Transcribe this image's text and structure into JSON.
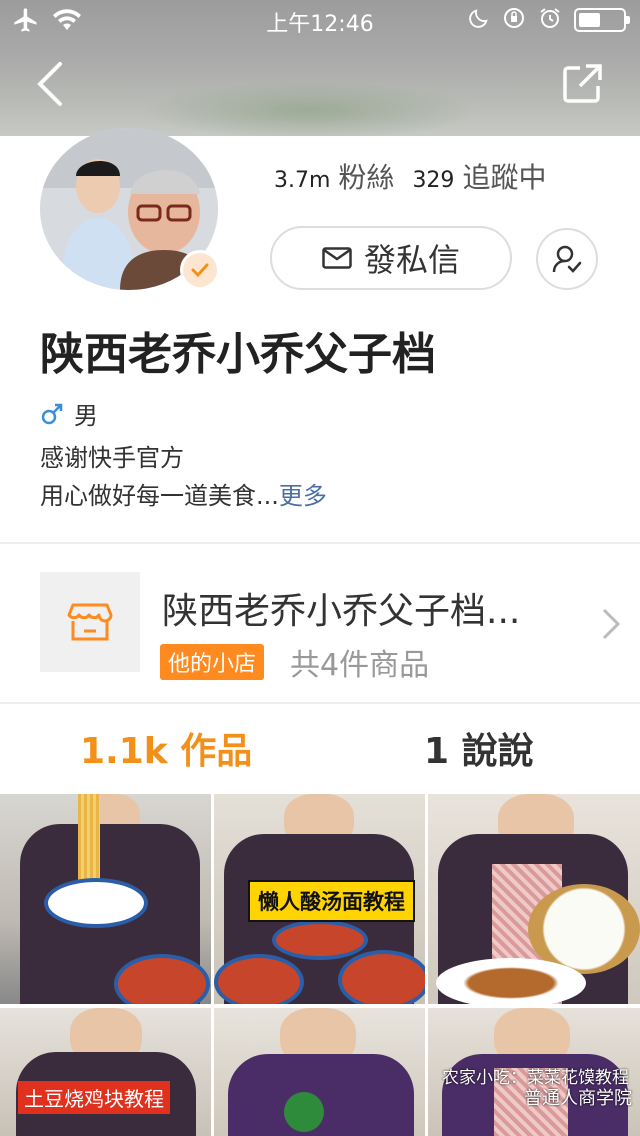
{
  "status_bar": {
    "time": "上午12:46",
    "icons": [
      "airplane-icon",
      "wifi-icon",
      "moon-icon",
      "rotation-lock-icon",
      "alarm-icon",
      "battery-icon"
    ],
    "battery_level": 0.5
  },
  "header": {
    "back_icon": "chevron-left-icon",
    "share_icon": "share-icon"
  },
  "profile": {
    "followers_count": "3.7m",
    "followers_label": "粉絲",
    "following_count": "329",
    "following_label": "追蹤中",
    "message_button": "發私信",
    "name": "陕西老乔小乔父子档",
    "gender": "男",
    "bio_line1": "感谢快手官方",
    "bio_line2": "用心做好每一道美食...",
    "more_link": "更多",
    "accent_color": "#f39019"
  },
  "shop": {
    "title": "陕西老乔小乔父子档...",
    "tag": "他的小店",
    "count": "共4件商品"
  },
  "tabs": {
    "works": "1.1k 作品",
    "posts": "1 說說"
  },
  "grid": {
    "items": [
      {
        "caption": ""
      },
      {
        "caption": "懒人酸汤面教程"
      },
      {
        "caption": ""
      },
      {
        "caption": "土豆烧鸡块教程"
      },
      {
        "caption": ""
      },
      {
        "caption": "农家小吃：菜菜花馍教程"
      }
    ],
    "watermark": "普通人商学院"
  }
}
